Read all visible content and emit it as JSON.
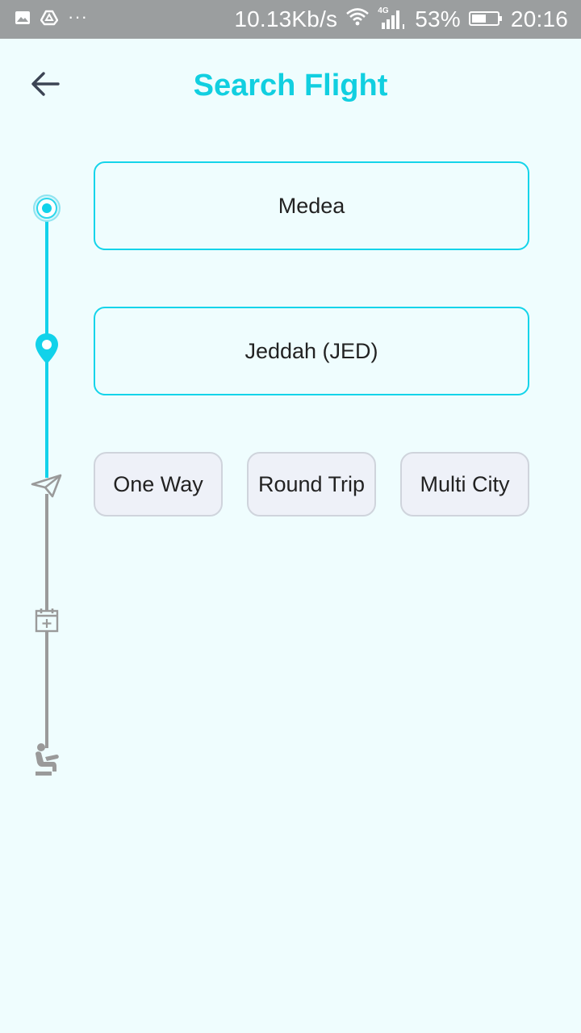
{
  "status_bar": {
    "network_speed": "10.13Kb/s",
    "network_type": "4G",
    "battery": "53%",
    "time": "20:16",
    "more": "···",
    "icons": [
      "image-icon",
      "drive-icon",
      "wifi-icon",
      "signal-icon",
      "battery-icon"
    ]
  },
  "header": {
    "title": "Search Flight",
    "back_icon": "arrow-left-icon"
  },
  "form": {
    "from_value": "Medea",
    "to_value": "Jeddah (JED)"
  },
  "trip_types": {
    "one_way": "One Way",
    "round_trip": "Round Trip",
    "multi_city": "Multi City"
  },
  "timeline": {
    "steps": [
      "origin-dot-icon",
      "destination-pin-icon",
      "paper-plane-icon",
      "calendar-icon",
      "passenger-seat-icon"
    ]
  },
  "colors": {
    "accent": "#12d2ea",
    "title": "#11cfe0",
    "inactive": "#9a9a9a",
    "background": "#effdfe",
    "status_bar": "#9b9e9f"
  }
}
